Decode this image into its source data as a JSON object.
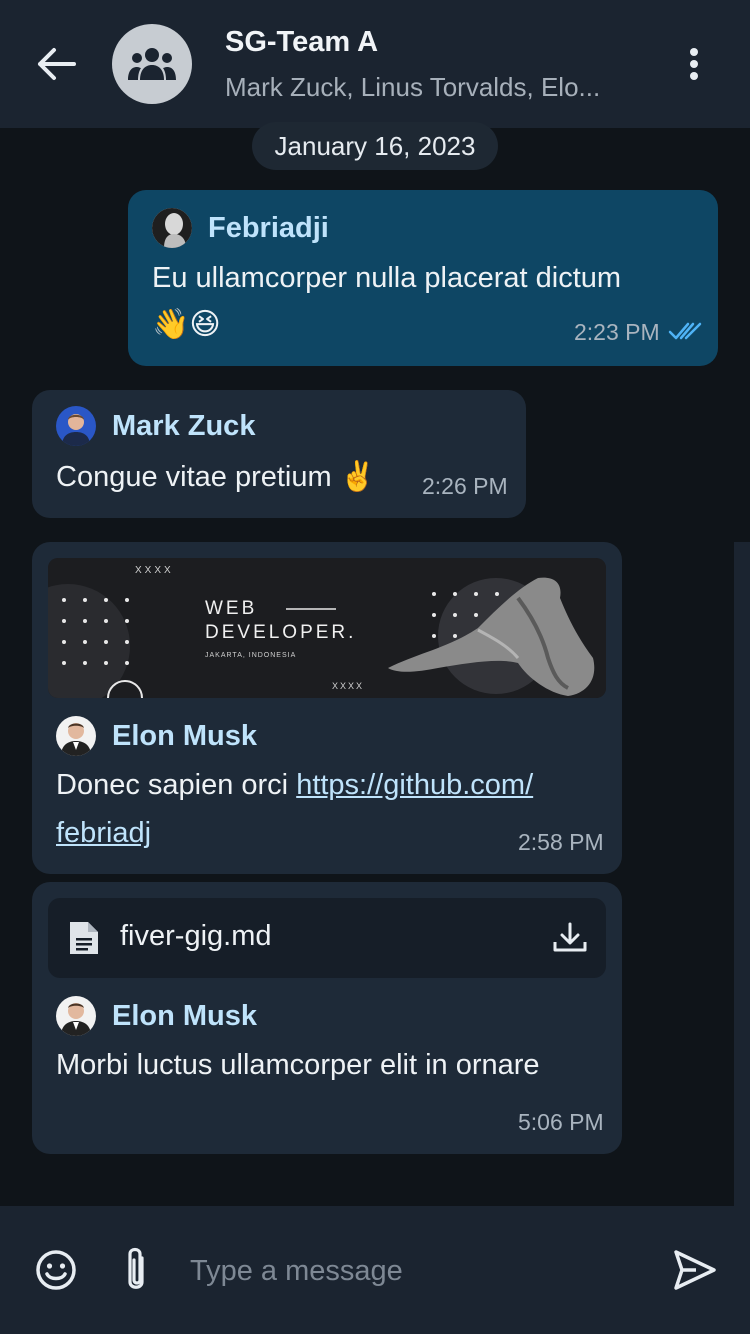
{
  "header": {
    "title": "SG-Team A",
    "subtitle": "Mark Zuck, Linus Torvalds, Elo..."
  },
  "date_separator": "January 16, 2023",
  "messages": [
    {
      "sender": "Febriadji",
      "text_line1": "Eu ullamcorper nulla placerat dictum",
      "emojis": "👋😆",
      "time": "2:23 PM",
      "direction": "outgoing",
      "status": "read"
    },
    {
      "sender": "Mark Zuck",
      "text": "Congue vitae pretium ✌️",
      "time": "2:26 PM",
      "direction": "incoming"
    },
    {
      "sender": "Elon Musk",
      "text_prefix": "Donec sapien orci ",
      "link_line1": "https://github.com/",
      "link_line2": "febriadj",
      "time": "2:58 PM",
      "direction": "incoming",
      "banner": {
        "title_line1": "WEB",
        "title_line2": "DEVELOPER.",
        "location": "JAKARTA, INDONESIA",
        "mark_top": "XXXX",
        "mark_bottom": "XXXX"
      }
    },
    {
      "sender": "Elon Musk",
      "file_name": "fiver-gig.md",
      "text": "Morbi luctus ullamcorper elit in ornare",
      "time": "5:06 PM",
      "direction": "incoming"
    }
  ],
  "composer": {
    "placeholder": "Type a message"
  },
  "colors": {
    "background": "#0f1419",
    "header": "#1b2430",
    "outgoing_bubble": "#0e4664",
    "incoming_bubble": "#1e2a38",
    "sender_name": "#bfe3fb",
    "read_ticks": "#4fb3f6"
  }
}
